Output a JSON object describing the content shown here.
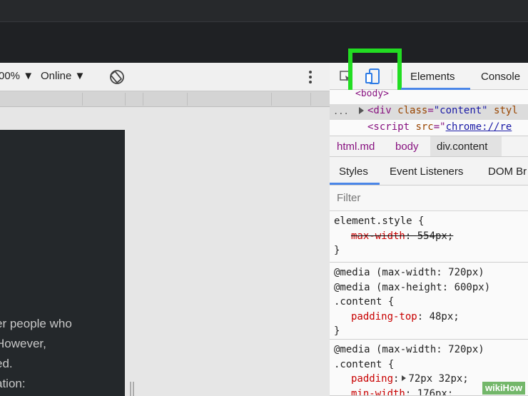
{
  "device_toolbar": {
    "zoom": "00%",
    "network": "Online"
  },
  "emulated_page": {
    "lines": [
      "er people who",
      "However,",
      "ed.",
      "ation:"
    ]
  },
  "devtools": {
    "tabs": {
      "elements": "Elements",
      "console": "Console"
    },
    "dom": {
      "body_tag": "<body>",
      "dots": "...",
      "div_open": "<div ",
      "div_attr": "class",
      "div_eq": "=",
      "div_val": "\"content\"",
      "div_attr2": " styl",
      "script_open": "<script ",
      "script_attr": "src",
      "script_eq": "=\"",
      "script_link": "chrome://re"
    },
    "breadcrumb": {
      "html": "html.md",
      "body": "body",
      "div": "div.content"
    },
    "sub_tabs": {
      "styles": "Styles",
      "events": "Event Listeners",
      "dom": "DOM Br"
    },
    "filter_placeholder": "Filter",
    "rules": {
      "r1": {
        "selector": "element.style {",
        "prop": "max-width",
        "colon": ": ",
        "value": "554px;",
        "close": "}"
      },
      "r2": {
        "media1": "@media (max-width: 720px)",
        "media2": "@media (max-height: 600px)",
        "selector": ".content {",
        "prop": "padding-top",
        "colon": ": ",
        "value": "48px;",
        "close": "}"
      },
      "r3": {
        "media1": "@media (max-width: 720px)",
        "selector": ".content {",
        "prop1": "padding",
        "colon1": ":",
        "value1": "72px 32px;",
        "prop2": "min-width",
        "colon2": ": ",
        "value2": "176px;"
      }
    }
  },
  "watermark": "wikiHow",
  "colors": {
    "highlight": "#22dd22",
    "accent": "#4a86e8"
  }
}
